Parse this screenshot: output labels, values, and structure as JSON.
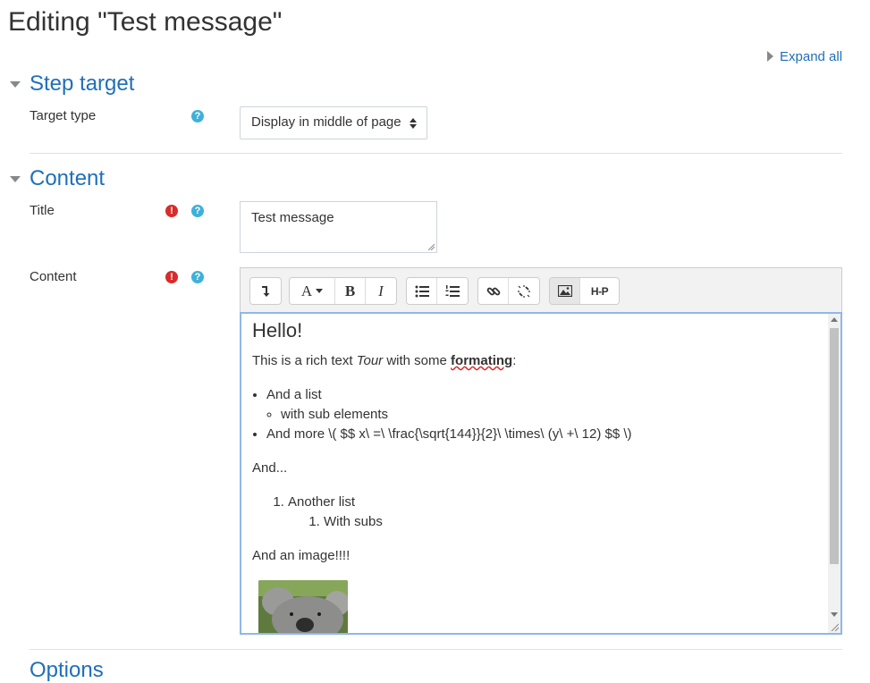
{
  "page": {
    "title": "Editing \"Test message\"",
    "expand_all": "Expand all"
  },
  "sections": {
    "step_target": {
      "title": "Step target",
      "target_type_label": "Target type",
      "target_type_value": "Display in middle of page"
    },
    "content": {
      "title": "Content",
      "title_label": "Title",
      "title_value": "Test message",
      "content_label": "Content"
    },
    "options": {
      "title": "Options"
    }
  },
  "toolbar": {
    "items": [
      "collapse",
      "paragraph-styles",
      "bold",
      "italic",
      "unordered-list",
      "ordered-list",
      "link",
      "unlink",
      "image",
      "h5p"
    ],
    "para_label": "A",
    "bold": "B",
    "italic": "I",
    "h5p": "H-P"
  },
  "editor": {
    "heading": "Hello!",
    "p1_a": "This is a rich text ",
    "p1_tour": "Tour",
    "p1_b": " with some ",
    "p1_formating": "formating",
    "p1_c": ":",
    "list1": "And a list",
    "list1_sub": "with sub elements",
    "list2": "And more \\( $$ x\\ =\\ \\frac{\\sqrt{144}}{2}\\ \\times\\ (y\\ +\\ 12) $$ \\)",
    "and": "And...",
    "ol1": "Another list",
    "ol1_sub": "With subs",
    "and_image": "And an image!!!!"
  },
  "colors": {
    "link": "#1f6fb8",
    "help": "#3fb1d8",
    "required": "#d72c2c",
    "focus_border": "#8fb8e6"
  }
}
